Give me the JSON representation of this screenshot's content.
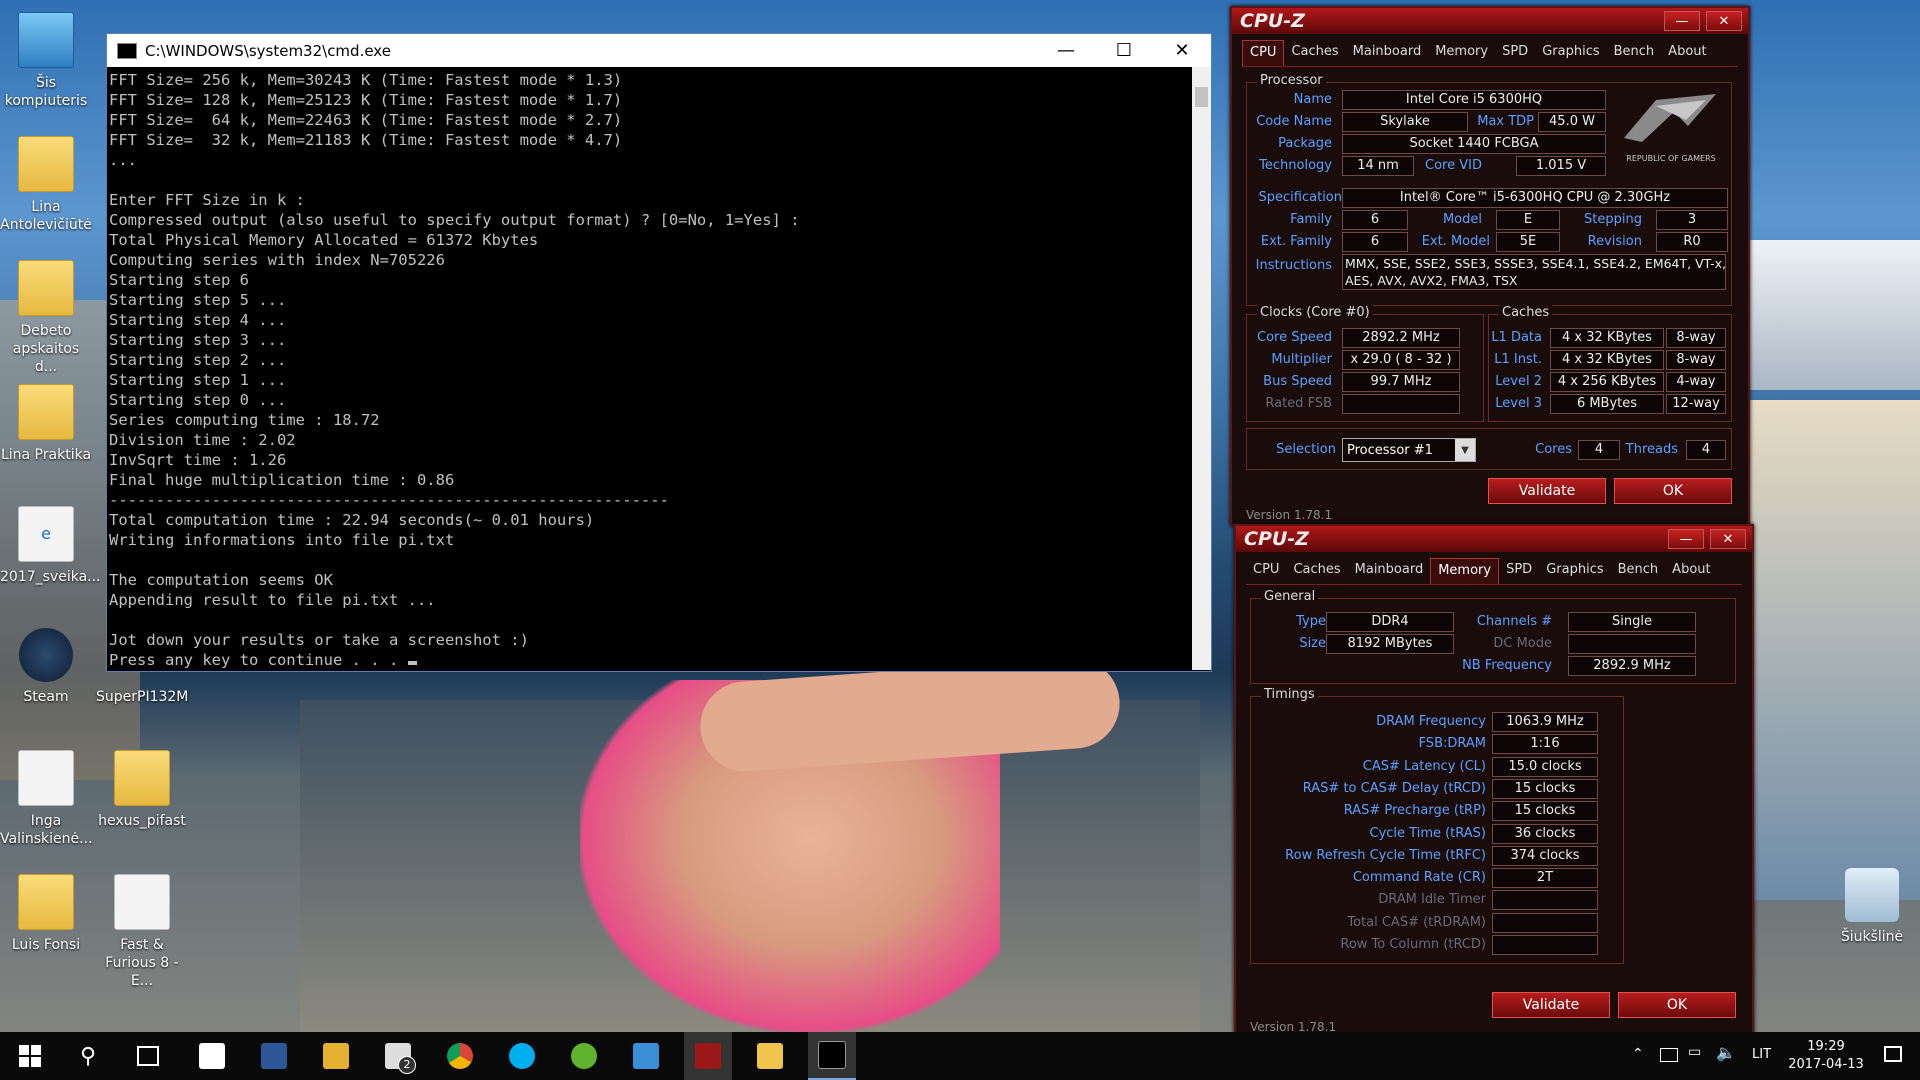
{
  "desktop": {
    "icons": [
      {
        "label": "Šis kompiuteris"
      },
      {
        "label": "Lina Antolevičiūtė"
      },
      {
        "label": "Debeto apskaitos d..."
      },
      {
        "label": "Lina Praktika"
      },
      {
        "label": "2017_sveika..."
      },
      {
        "label": "Steam"
      },
      {
        "label": "SuperPI132M"
      },
      {
        "label": "Inga Valinskienė..."
      },
      {
        "label": "hexus_pifast"
      },
      {
        "label": "Luis Fonsi"
      },
      {
        "label": "Fast & Furious 8 - E..."
      },
      {
        "label": "Šiukšlinė"
      }
    ]
  },
  "cmd": {
    "title": "C:\\WINDOWS\\system32\\cmd.exe",
    "lines": [
      "FFT Size= 256 k, Mem=30243 K (Time: Fastest mode * 1.3)",
      "FFT Size= 128 k, Mem=25123 K (Time: Fastest mode * 1.7)",
      "FFT Size=  64 k, Mem=22463 K (Time: Fastest mode * 2.7)",
      "FFT Size=  32 k, Mem=21183 K (Time: Fastest mode * 4.7)",
      "...",
      "",
      "Enter FFT Size in k :",
      "Compressed output (also useful to specify output format) ? [0=No, 1=Yes] :",
      "Total Physical Memory Allocated = 61372 Kbytes",
      "Computing series with index N=705226",
      "Starting step 6",
      "Starting step 5 ...",
      "Starting step 4 ...",
      "Starting step 3 ...",
      "Starting step 2 ...",
      "Starting step 1 ...",
      "Starting step 0 ...",
      "Series computing time : 18.72",
      "Division time : 2.02",
      "InvSqrt time : 1.26",
      "Final huge multiplication time : 0.86",
      "------------------------------------------------------------",
      "Total computation time : 22.94 seconds(~ 0.01 hours)",
      "Writing informations into file pi.txt",
      "",
      "The computation seems OK",
      "Appending result to file pi.txt ...",
      "",
      "Jot down your results or take a screenshot :)",
      "Press any key to continue . . . "
    ]
  },
  "cpuz_cpu": {
    "logo": "CPU-Z",
    "tabs": [
      "CPU",
      "Caches",
      "Mainboard",
      "Memory",
      "SPD",
      "Graphics",
      "Bench",
      "About"
    ],
    "active_tab": "CPU",
    "processor_group": "Processor",
    "labels": {
      "name": "Name",
      "code_name": "Code Name",
      "max_tdp": "Max TDP",
      "package": "Package",
      "technology": "Technology",
      "core_vid": "Core VID",
      "specification": "Specification",
      "family": "Family",
      "model": "Model",
      "stepping": "Stepping",
      "ext_family": "Ext. Family",
      "ext_model": "Ext. Model",
      "revision": "Revision",
      "instructions": "Instructions",
      "clocks_group": "Clocks (Core #0)",
      "caches_group": "Caches",
      "core_speed": "Core Speed",
      "multiplier": "Multiplier",
      "bus_speed": "Bus Speed",
      "rated_fsb": "Rated FSB",
      "l1_data": "L1 Data",
      "l1_inst": "L1 Inst.",
      "level2": "Level 2",
      "level3": "Level 3",
      "selection": "Selection",
      "cores": "Cores",
      "threads": "Threads"
    },
    "values": {
      "name": "Intel Core i5 6300HQ",
      "code_name": "Skylake",
      "max_tdp": "45.0 W",
      "package": "Socket 1440 FCBGA",
      "technology": "14 nm",
      "core_vid": "1.015 V",
      "specification": "Intel® Core™ i5-6300HQ CPU @ 2.30GHz",
      "family": "6",
      "model": "E",
      "stepping": "3",
      "ext_family": "6",
      "ext_model": "5E",
      "revision": "R0",
      "instructions_1": "MMX, SSE, SSE2, SSE3, SSSE3, SSE4.1, SSE4.2, EM64T, VT-x,",
      "instructions_2": "AES, AVX, AVX2, FMA3, TSX",
      "core_speed": "2892.2 MHz",
      "multiplier": "x 29.0 ( 8 - 32 )",
      "bus_speed": "99.7 MHz",
      "rated_fsb": "",
      "l1_data": "4 x 32 KBytes",
      "l1_data_way": "8-way",
      "l1_inst": "4 x 32 KBytes",
      "l1_inst_way": "8-way",
      "level2": "4 x 256 KBytes",
      "level2_way": "4-way",
      "level3": "6 MBytes",
      "level3_way": "12-way",
      "selection": "Processor #1",
      "cores": "4",
      "threads": "4"
    },
    "brand_text": "REPUBLIC OF GAMERS",
    "validate": "Validate",
    "ok": "OK",
    "version": "Version 1.78.1"
  },
  "cpuz_mem": {
    "logo": "CPU-Z",
    "tabs": [
      "CPU",
      "Caches",
      "Mainboard",
      "Memory",
      "SPD",
      "Graphics",
      "Bench",
      "About"
    ],
    "active_tab": "Memory",
    "general_group": "General",
    "timings_group": "Timings",
    "labels": {
      "type": "Type",
      "size": "Size",
      "channels": "Channels #",
      "dc_mode": "DC Mode",
      "nb_frequency": "NB Frequency",
      "dram_freq": "DRAM Frequency",
      "fsb_dram": "FSB:DRAM",
      "cas": "CAS# Latency (CL)",
      "trcd": "RAS# to CAS# Delay (tRCD)",
      "trp": "RAS# Precharge (tRP)",
      "tras": "Cycle Time (tRAS)",
      "trfc": "Row Refresh Cycle Time (tRFC)",
      "cr": "Command Rate (CR)",
      "idle": "DRAM Idle Timer",
      "trdram": "Total CAS# (tRDRAM)",
      "trcd2": "Row To Column (tRCD)"
    },
    "values": {
      "type": "DDR4",
      "size": "8192 MBytes",
      "channels": "Single",
      "dc_mode": "",
      "nb_frequency": "2892.9 MHz",
      "dram_freq": "1063.9 MHz",
      "fsb_dram": "1:16",
      "cas": "15.0 clocks",
      "trcd": "15 clocks",
      "trp": "15 clocks",
      "tras": "36 clocks",
      "trfc": "374 clocks",
      "cr": "2T",
      "idle": "",
      "trdram": "",
      "trcd2": ""
    },
    "validate": "Validate",
    "ok": "OK",
    "version": "Version 1.78.1"
  },
  "taskbar": {
    "mail_badge": "2",
    "language": "LIT",
    "time": "19:29",
    "date": "2017-04-13"
  }
}
